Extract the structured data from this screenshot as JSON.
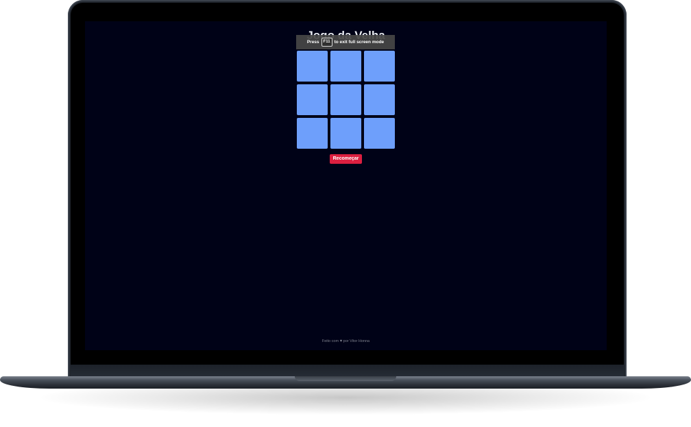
{
  "page": {
    "title": "Jogo da Velha"
  },
  "fullscreen_notice": {
    "before": "Press",
    "key": "F11",
    "after": "to exit full screen mode"
  },
  "board": {
    "cells": [
      "",
      "",
      "",
      "",
      "",
      "",
      "",
      "",
      ""
    ]
  },
  "restart_button": {
    "label": "Recomeçar"
  },
  "footer": {
    "before": "Feito com",
    "icon": "heart-icon",
    "after": "por Vitor Honna"
  },
  "colors": {
    "background": "#000217",
    "cell": "#6e9ffb",
    "button": "#dc1f40",
    "title": "#e9ecf1"
  }
}
